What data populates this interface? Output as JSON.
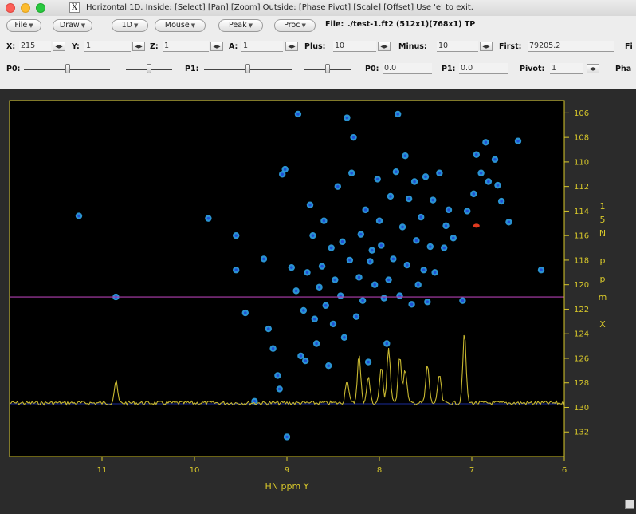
{
  "window": {
    "title": "Horizontal 1D.   Inside: [Select] [Pan] [Zoom]   Outside: [Phase Pivot] [Scale] [Offset]   Use 'e' to exit.",
    "logo_glyph": "X"
  },
  "menus": [
    "File",
    "Draw",
    "1D",
    "Mouse",
    "Peak",
    "Proc"
  ],
  "file_info": {
    "label": "File:",
    "value": "./test-1.ft2 (512x1)(768x1) TP"
  },
  "params": {
    "x": {
      "label": "X:",
      "value": "215"
    },
    "y": {
      "label": "Y:",
      "value": "1"
    },
    "z": {
      "label": "Z:",
      "value": "1"
    },
    "a": {
      "label": "A:",
      "value": "1"
    },
    "plus": {
      "label": "Plus:",
      "value": "10"
    },
    "minus": {
      "label": "Minus:",
      "value": "10"
    },
    "first": {
      "label": "First:",
      "value": "79205.2"
    },
    "trailing": "Fi"
  },
  "phase": {
    "p0_slider_label": "P0:",
    "p1_slider_label": "P1:",
    "p0": {
      "label": "P0:",
      "value": "0.0"
    },
    "p1": {
      "label": "P1:",
      "value": "0.0"
    },
    "pivot": {
      "label": "Pivot:",
      "value": "1"
    },
    "trailing": "Pha"
  },
  "colors": {
    "plot_background": "#000000",
    "axis": "#d9c92a",
    "peak_contour": "#2fa3e8",
    "peak_core": "#1f4fd8",
    "negative_peak": "#e03a1f",
    "slice_trace": "#c8b830",
    "cursor_line": "#b03fb0",
    "baseline": "#1a2b9a"
  },
  "chart_data": {
    "type": "scatter",
    "xlabel": "HN ppm Y",
    "ylabel": "15N ppm X",
    "xlim": [
      12.0,
      6.0
    ],
    "ylim": [
      105.0,
      134.0
    ],
    "x_ticks": [
      "11",
      "10",
      "9",
      "8",
      "7",
      "6"
    ],
    "y_ticks": [
      "106",
      "108",
      "110",
      "112",
      "114",
      "116",
      "118",
      "120",
      "122",
      "124",
      "126",
      "128",
      "130",
      "132"
    ],
    "cursor_15n_ppm": 121.0,
    "peaks": [
      [
        11.25,
        114.4
      ],
      [
        10.85,
        121.0
      ],
      [
        9.85,
        114.6
      ],
      [
        9.55,
        116.0
      ],
      [
        9.55,
        118.8
      ],
      [
        9.45,
        122.3
      ],
      [
        9.35,
        129.5
      ],
      [
        9.25,
        117.9
      ],
      [
        9.2,
        123.6
      ],
      [
        9.15,
        125.2
      ],
      [
        9.1,
        127.4
      ],
      [
        9.08,
        128.5
      ],
      [
        9.05,
        111.0
      ],
      [
        9.02,
        110.6
      ],
      [
        9.0,
        132.4
      ],
      [
        8.95,
        118.6
      ],
      [
        8.9,
        120.5
      ],
      [
        8.88,
        106.1
      ],
      [
        8.85,
        125.8
      ],
      [
        8.82,
        122.1
      ],
      [
        8.8,
        126.2
      ],
      [
        8.78,
        119.0
      ],
      [
        8.75,
        113.5
      ],
      [
        8.72,
        116.0
      ],
      [
        8.7,
        122.8
      ],
      [
        8.68,
        124.8
      ],
      [
        8.65,
        120.2
      ],
      [
        8.62,
        118.5
      ],
      [
        8.6,
        114.8
      ],
      [
        8.58,
        121.7
      ],
      [
        8.55,
        126.6
      ],
      [
        8.52,
        117.0
      ],
      [
        8.5,
        123.2
      ],
      [
        8.48,
        119.6
      ],
      [
        8.45,
        112.0
      ],
      [
        8.42,
        120.9
      ],
      [
        8.4,
        116.5
      ],
      [
        8.38,
        124.3
      ],
      [
        8.35,
        106.4
      ],
      [
        8.32,
        118.0
      ],
      [
        8.3,
        110.9
      ],
      [
        8.28,
        108.0
      ],
      [
        8.25,
        122.6
      ],
      [
        8.22,
        119.4
      ],
      [
        8.2,
        115.9
      ],
      [
        8.18,
        121.3
      ],
      [
        8.15,
        113.9
      ],
      [
        8.12,
        126.3
      ],
      [
        8.1,
        118.1
      ],
      [
        8.08,
        117.2
      ],
      [
        8.05,
        120.0
      ],
      [
        8.02,
        111.4
      ],
      [
        8.0,
        114.8
      ],
      [
        7.98,
        116.8
      ],
      [
        7.95,
        121.1
      ],
      [
        7.92,
        124.8
      ],
      [
        7.9,
        119.6
      ],
      [
        7.88,
        112.8
      ],
      [
        7.85,
        117.9
      ],
      [
        7.82,
        110.8
      ],
      [
        7.8,
        106.1
      ],
      [
        7.78,
        120.9
      ],
      [
        7.75,
        115.3
      ],
      [
        7.72,
        109.5
      ],
      [
        7.7,
        118.4
      ],
      [
        7.68,
        113.0
      ],
      [
        7.65,
        121.6
      ],
      [
        7.62,
        111.6
      ],
      [
        7.6,
        116.4
      ],
      [
        7.58,
        120.0
      ],
      [
        7.55,
        114.5
      ],
      [
        7.52,
        118.8
      ],
      [
        7.5,
        111.2
      ],
      [
        7.48,
        121.4
      ],
      [
        7.45,
        116.9
      ],
      [
        7.42,
        113.1
      ],
      [
        7.4,
        119.0
      ],
      [
        7.35,
        110.9
      ],
      [
        7.3,
        117.0
      ],
      [
        7.28,
        115.2
      ],
      [
        7.25,
        113.9
      ],
      [
        7.2,
        116.2
      ],
      [
        7.1,
        121.3
      ],
      [
        7.05,
        114.0
      ],
      [
        6.98,
        112.6
      ],
      [
        6.95,
        109.4
      ],
      [
        6.9,
        110.9
      ],
      [
        6.85,
        108.4
      ],
      [
        6.82,
        111.6
      ],
      [
        6.75,
        109.8
      ],
      [
        6.72,
        111.9
      ],
      [
        6.68,
        113.2
      ],
      [
        6.6,
        114.9
      ],
      [
        6.5,
        108.3
      ],
      [
        6.25,
        118.8
      ]
    ],
    "negative_peaks": [
      [
        6.95,
        115.2
      ]
    ],
    "slice_peaks": [
      {
        "x": 10.85,
        "height": 0.45
      },
      {
        "x": 8.35,
        "height": 0.5
      },
      {
        "x": 8.22,
        "height": 1.0
      },
      {
        "x": 8.12,
        "height": 0.55
      },
      {
        "x": 7.98,
        "height": 0.75
      },
      {
        "x": 7.9,
        "height": 1.15
      },
      {
        "x": 7.78,
        "height": 1.0
      },
      {
        "x": 7.72,
        "height": 0.7
      },
      {
        "x": 7.48,
        "height": 0.8
      },
      {
        "x": 7.35,
        "height": 0.6
      },
      {
        "x": 7.08,
        "height": 1.45
      }
    ]
  }
}
